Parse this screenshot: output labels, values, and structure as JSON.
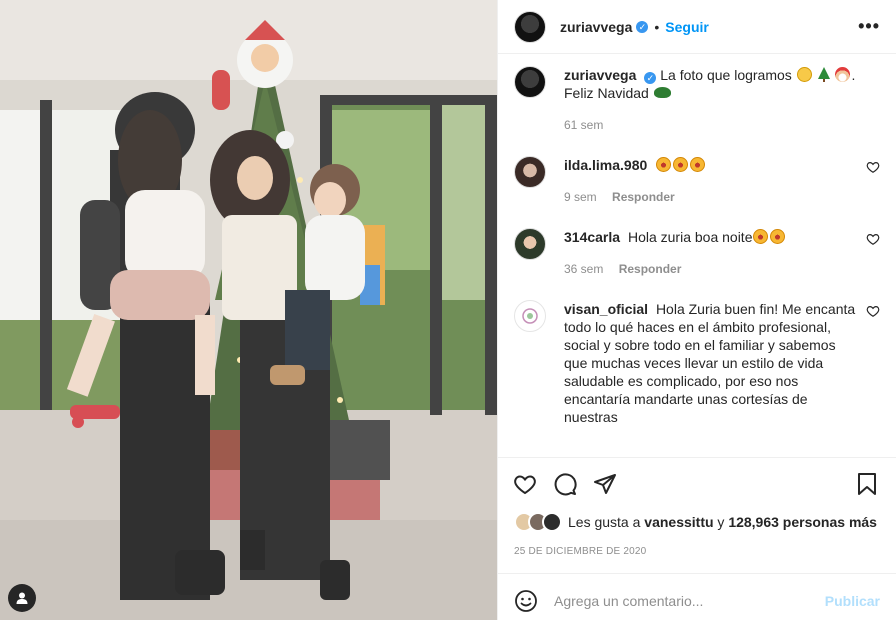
{
  "post": {
    "username": "zuriavvega",
    "verified_icon": "verified-badge-icon",
    "separator": "•",
    "follow_label": "Seguir",
    "more_label": "•••"
  },
  "caption": {
    "username": "zuriavvega",
    "text_1": "La foto que logramos",
    "text_2": ".",
    "text_3": "Feliz Navidad",
    "age": "61 sem"
  },
  "comments": [
    {
      "username": "ilda.lima.980",
      "text": "",
      "age": "9 sem",
      "reply": "Responder"
    },
    {
      "username": "314carla",
      "text": "Hola zuria boa noite",
      "age": "36 sem",
      "reply": "Responder"
    },
    {
      "username": "visan_oficial",
      "text": "Hola Zuria buen fin! Me encanta todo lo qué haces en el ámbito profesional, social y sobre todo en el familiar y sabemos que muchas veces llevar un estilo de vida saludable es complicado, por eso nos encantaría mandarte unas cortesías de nuestras"
    }
  ],
  "likes": {
    "prefix": "Les gusta a",
    "user": "vanessittu",
    "middle": "y",
    "count": "128,963 personas más"
  },
  "date": "25 DE DICIEMBRE DE 2020",
  "add_comment": {
    "placeholder": "Agrega un comentario...",
    "publish": "Publicar"
  },
  "colors": {
    "accent": "#0095f6",
    "publish_disabled": "#b2dffc",
    "muted": "#8e8e8e",
    "text": "#262626"
  }
}
